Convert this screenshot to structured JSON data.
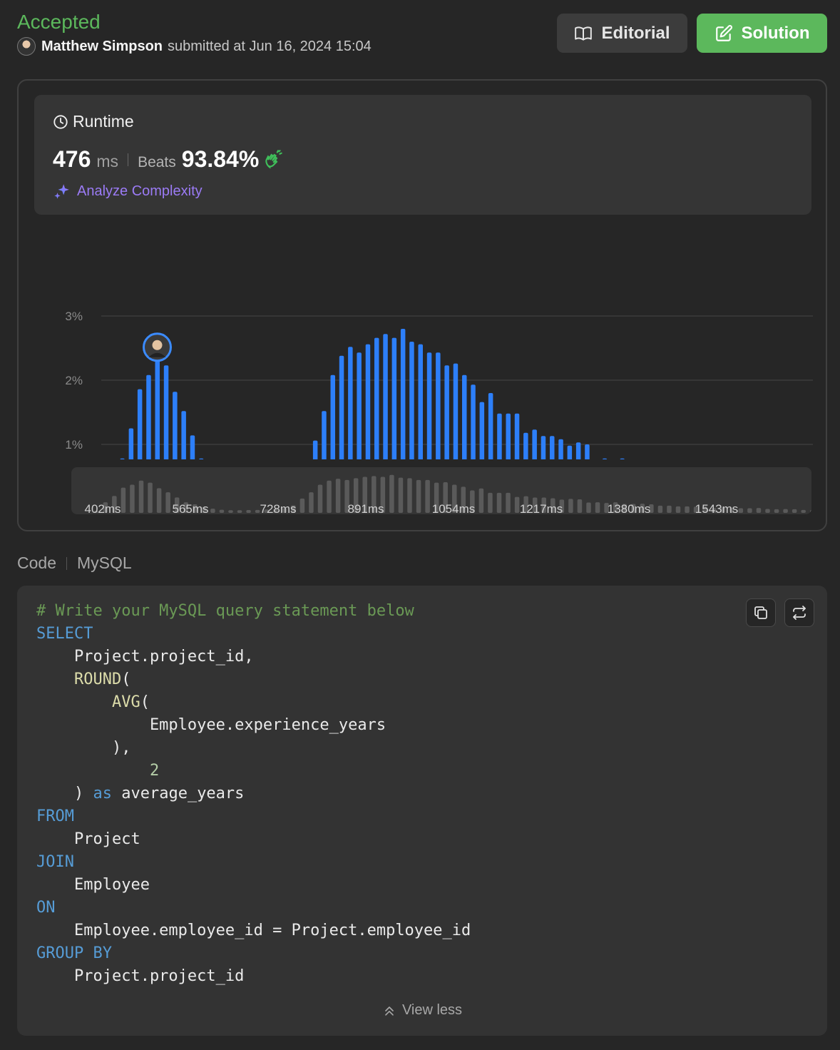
{
  "header": {
    "status": "Accepted",
    "user_name": "Matthew Simpson",
    "submitted_text": "submitted at Jun 16, 2024 15:04"
  },
  "buttons": {
    "editorial": "Editorial",
    "solution": "Solution"
  },
  "runtime": {
    "title": "Runtime",
    "value": "476",
    "unit": "ms",
    "beats_label": "Beats",
    "beats_value": "93.84%",
    "analyze_label": "Analyze Complexity"
  },
  "chart_data": {
    "type": "bar",
    "ylabel": "",
    "xlabel": "",
    "y_ticks": [
      "0%",
      "1%",
      "2%",
      "3%"
    ],
    "ylim": [
      0,
      3
    ],
    "x_ticks": [
      "402ms",
      "565ms",
      "728ms",
      "891ms",
      "1054ms",
      "1217ms",
      "1380ms",
      "1543ms"
    ],
    "highlight_index": 5,
    "grid": true,
    "values": [
      0.12,
      0.78,
      1.25,
      1.86,
      2.08,
      2.38,
      2.23,
      1.82,
      1.52,
      1.14,
      0.78,
      0.63,
      0.42,
      0.31,
      0.23,
      0.2,
      0.2,
      0.21,
      0.22,
      0.25,
      0.28,
      0.33,
      0.56,
      1.06,
      1.52,
      2.08,
      2.38,
      2.52,
      2.43,
      2.56,
      2.66,
      2.72,
      2.66,
      2.8,
      2.6,
      2.56,
      2.43,
      2.43,
      2.23,
      2.26,
      2.08,
      1.93,
      1.66,
      1.8,
      1.48,
      1.48,
      1.48,
      1.18,
      1.23,
      1.13,
      1.13,
      1.08,
      0.98,
      1.03,
      1.0,
      0.76,
      0.78,
      0.73,
      0.78,
      0.66,
      0.66,
      0.68,
      0.63,
      0.53,
      0.53,
      0.48,
      0.48,
      0.46,
      0.48,
      0.36,
      0.41,
      0.38,
      0.34,
      0.34,
      0.36,
      0.29,
      0.27,
      0.28,
      0.27,
      0.22,
      0.21
    ]
  },
  "code": {
    "label": "Code",
    "language": "MySQL",
    "view_less": "View less",
    "lines": [
      [
        {
          "t": "# Write your MySQL query statement below",
          "c": "comment"
        }
      ],
      [
        {
          "t": "SELECT",
          "c": "kw"
        }
      ],
      [
        {
          "t": "    Project.project_id,",
          "c": ""
        }
      ],
      [
        {
          "t": "    ",
          "c": ""
        },
        {
          "t": "ROUND",
          "c": "fn"
        },
        {
          "t": "(",
          "c": ""
        }
      ],
      [
        {
          "t": "        ",
          "c": ""
        },
        {
          "t": "AVG",
          "c": "fn"
        },
        {
          "t": "(",
          "c": ""
        }
      ],
      [
        {
          "t": "            Employee.experience_years",
          "c": ""
        }
      ],
      [
        {
          "t": "        ),",
          "c": ""
        }
      ],
      [
        {
          "t": "            ",
          "c": ""
        },
        {
          "t": "2",
          "c": "num"
        }
      ],
      [
        {
          "t": "    ) ",
          "c": ""
        },
        {
          "t": "as",
          "c": "kw"
        },
        {
          "t": " average_years",
          "c": ""
        }
      ],
      [
        {
          "t": "FROM",
          "c": "kw"
        }
      ],
      [
        {
          "t": "    Project",
          "c": ""
        }
      ],
      [
        {
          "t": "JOIN",
          "c": "kw"
        }
      ],
      [
        {
          "t": "    Employee",
          "c": ""
        }
      ],
      [
        {
          "t": "ON",
          "c": "kw"
        }
      ],
      [
        {
          "t": "    Employee.employee_id = Project.employee_id",
          "c": ""
        }
      ],
      [
        {
          "t": "GROUP BY",
          "c": "kw"
        }
      ],
      [
        {
          "t": "    Project.project_id",
          "c": ""
        }
      ]
    ]
  },
  "colors": {
    "bar": "#2d7ff9",
    "accent_green": "#5cb85c",
    "grid": "#474747",
    "mini_bar": "#5a5a5a"
  },
  "icons": {
    "editorial": "book-icon",
    "solution": "edit-icon",
    "runtime": "clock-icon",
    "beats": "clap-icon",
    "analyze": "sparkle-icon",
    "copy": "copy-icon",
    "switch": "switch-icon",
    "view_less": "chevron-up-icon"
  }
}
